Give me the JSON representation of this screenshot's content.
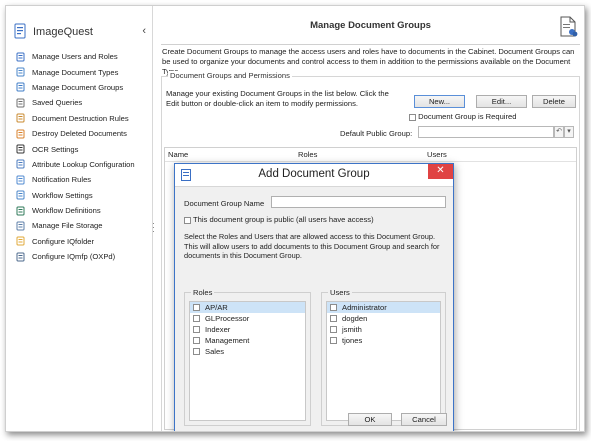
{
  "sidebar": {
    "app_title": "ImageQuest",
    "collapse_glyph": "‹",
    "items": [
      {
        "label": "Manage Users and Roles",
        "icon": "users-icon",
        "color": "#3a6fc4"
      },
      {
        "label": "Manage Document Types",
        "icon": "document-types-icon",
        "color": "#4a86c9"
      },
      {
        "label": "Manage Document Groups",
        "icon": "document-groups-icon",
        "color": "#3f7cc7"
      },
      {
        "label": "Saved Queries",
        "icon": "saved-queries-icon",
        "color": "#6f6f6f"
      },
      {
        "label": "Document Destruction Rules",
        "icon": "destruction-rules-icon",
        "color": "#c98a2f"
      },
      {
        "label": "Destroy Deleted Documents",
        "icon": "destroy-documents-icon",
        "color": "#d9822b"
      },
      {
        "label": "OCR Settings",
        "icon": "ocr-icon",
        "color": "#333333"
      },
      {
        "label": "Attribute Lookup Configuration",
        "icon": "attribute-lookup-icon",
        "color": "#4b7bbf"
      },
      {
        "label": "Notification Rules",
        "icon": "notification-icon",
        "color": "#4f8ad0"
      },
      {
        "label": "Workflow Settings",
        "icon": "workflow-settings-icon",
        "color": "#4a86c9"
      },
      {
        "label": "Workflow Definitions",
        "icon": "workflow-definitions-icon",
        "color": "#2f7a5a"
      },
      {
        "label": "Manage File Storage",
        "icon": "file-storage-icon",
        "color": "#5d7fa8"
      },
      {
        "label": "Configure IQfolder",
        "icon": "iqfolder-icon",
        "color": "#e0a93a"
      },
      {
        "label": "Configure IQmfp (OXPd)",
        "icon": "iqmfp-icon",
        "color": "#4c6a8d"
      }
    ]
  },
  "main": {
    "title": "Manage Document Groups",
    "description": "Create Document Groups to manage the access users and roles have to documents in the Cabinet.  Document Groups can be used to organize your documents and control access to them in addition to the permissions available on the Document Type.",
    "group_box": {
      "legend": "Document Groups and Permissions",
      "instructions": "Manage your existing Document Groups in the list below.  Click the Edit button or double-click an item to modify permissions.",
      "new_label": "New...",
      "edit_label": "Edit...",
      "delete_label": "Delete",
      "required_label": "Document Group is Required",
      "default_public_label": "Default Public Group:",
      "default_public_value": "",
      "reset_glyph": "↶",
      "dropdown_glyph": "▾",
      "columns": [
        "Name",
        "Roles",
        "Users"
      ]
    }
  },
  "dialog": {
    "title": "Add Document Group",
    "close_glyph": "✕",
    "name_label": "Document Group Name",
    "name_value": "",
    "public_label": "This document group is public (all users have access)",
    "hint": "Select the Roles and Users that are allowed access to this Document Group.  This will allow users to add documents to this Document Group and search for documents in this Document Group.",
    "roles_legend": "Roles",
    "roles": [
      {
        "label": "AP/AR",
        "selected": true
      },
      {
        "label": "GLProcessor",
        "selected": false
      },
      {
        "label": "Indexer",
        "selected": false
      },
      {
        "label": "Management",
        "selected": false
      },
      {
        "label": "Sales",
        "selected": false
      }
    ],
    "users_legend": "Users",
    "users": [
      {
        "label": "Administrator",
        "selected": true
      },
      {
        "label": "dogden",
        "selected": false
      },
      {
        "label": "jsmith",
        "selected": false
      },
      {
        "label": "tjones",
        "selected": false
      }
    ],
    "ok_label": "OK",
    "cancel_label": "Cancel"
  },
  "colors": {
    "accent": "#3d74c7",
    "close_red": "#e04343",
    "selection": "#cde3f7"
  }
}
